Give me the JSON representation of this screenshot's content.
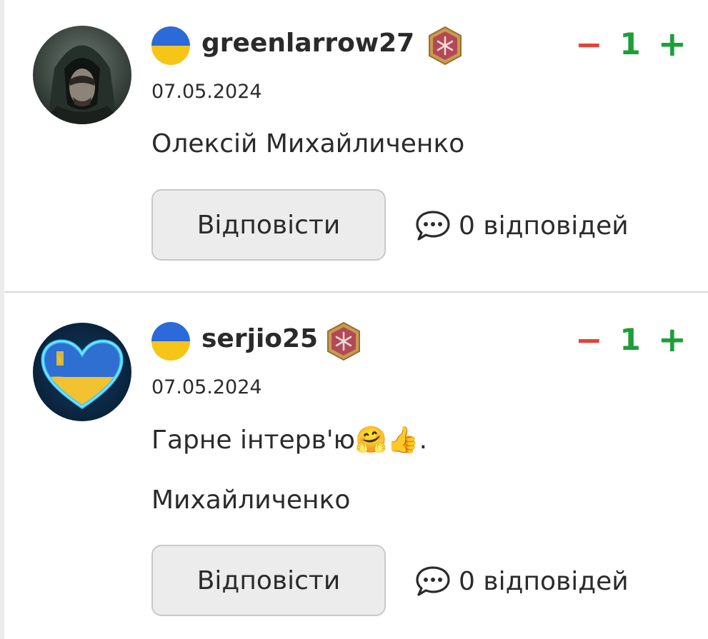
{
  "comments": [
    {
      "username": "greenlarrow27",
      "date": "07.05.2024",
      "lines": [
        "Олексій Михайличенко"
      ],
      "score": "1",
      "vote_minus": "−",
      "vote_plus": "+",
      "reply_label": "Відповісти",
      "replies_label": "0 відповідей",
      "avatar_icon": "hooded-archer-avatar",
      "flag_icon": "ukraine-flag-icon",
      "badge_icon": "rank-badge-icon"
    },
    {
      "username": "serjio25",
      "date": "07.05.2024",
      "line1_text": "Гарне інтерв'ю",
      "line1_emoji": "🤗👍",
      "line1_end": ".",
      "lines": [
        "Михайличенко"
      ],
      "score": "1",
      "vote_minus": "−",
      "vote_plus": "+",
      "reply_label": "Відповісти",
      "replies_label": "0 відповідей",
      "avatar_icon": "ukraine-heart-avatar",
      "flag_icon": "ukraine-flag-icon",
      "badge_icon": "rank-badge-icon"
    }
  ],
  "colors": {
    "minus": "#e0453a",
    "plus": "#1e9e3a",
    "flag_blue": "#2b6ad8",
    "flag_yellow": "#f5c518",
    "button_bg": "#ececec"
  }
}
